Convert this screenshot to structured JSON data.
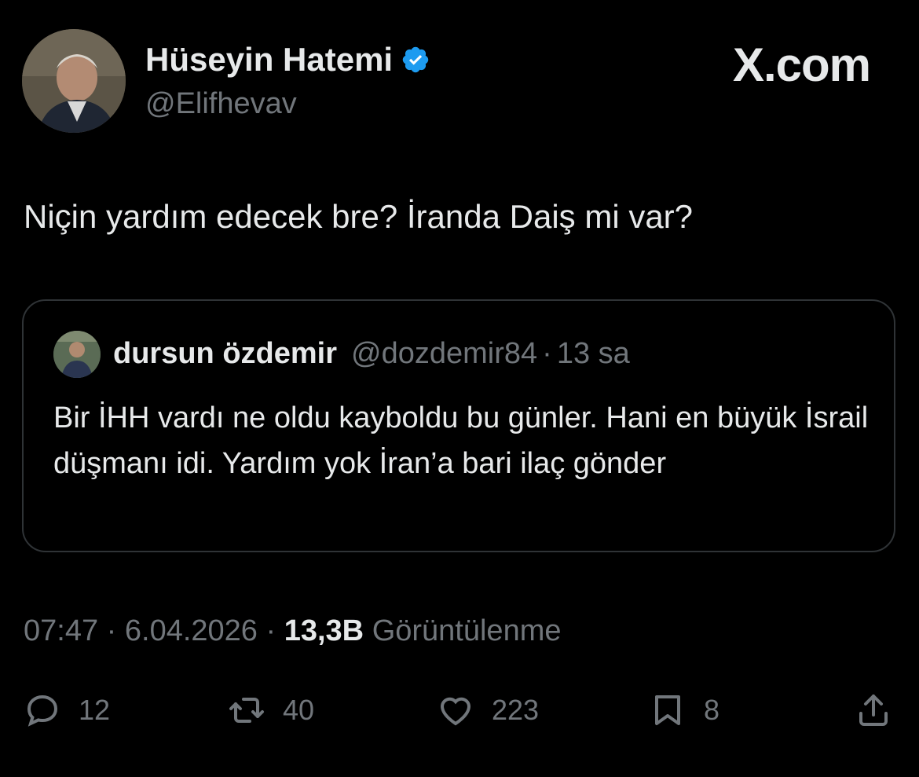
{
  "header": {
    "display_name": "Hüseyin Hatemi",
    "handle": "@Elifhevav",
    "brand": "X.com",
    "verified_icon": "verified-badge-icon",
    "accent_color": "#1d9bf0"
  },
  "tweet": {
    "text": "Niçin yardım edecek bre? İranda Daiş mi var?"
  },
  "quote": {
    "name": "dursun özdemir",
    "handle": "@dozdemir84",
    "separator": "·",
    "time": "13 sa",
    "text": "Bir İHH vardı ne oldu kayboldu bu günler. Hani en büyük İsrail düşmanı idi. Yardım yok İran’a bari ilaç gönder"
  },
  "meta": {
    "time": "07:47",
    "sep1": " · ",
    "date": "6.04.2026",
    "sep2": " · ",
    "views_count": "13,3B",
    "views_label": "Görüntülenme"
  },
  "actions": {
    "reply_count": "12",
    "retweet_count": "40",
    "like_count": "223",
    "bookmark_count": "8",
    "icons": [
      "reply-icon",
      "retweet-icon",
      "like-icon",
      "bookmark-icon",
      "share-icon"
    ]
  }
}
